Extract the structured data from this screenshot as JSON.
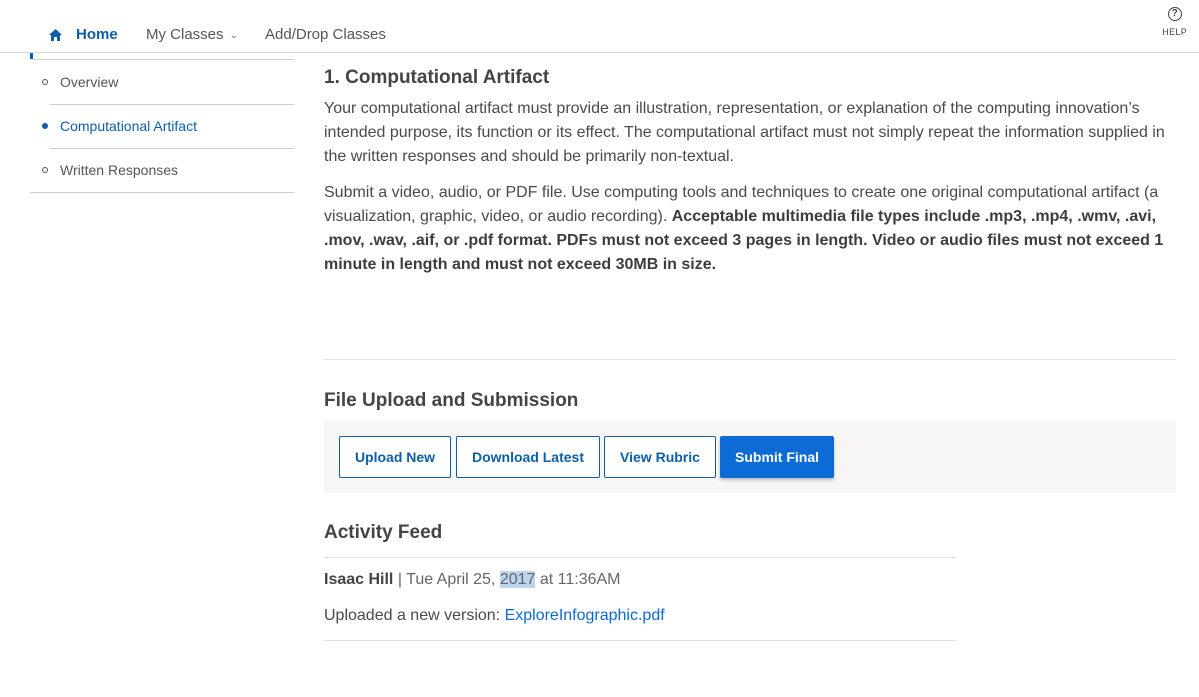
{
  "nav": {
    "home": "Home",
    "my_classes": "My Classes",
    "add_drop": "Add/Drop Classes",
    "help": "HELP",
    "help_glyph": "?"
  },
  "sidebar": {
    "items": [
      {
        "label": "Overview",
        "active": false
      },
      {
        "label": "Computational Artifact",
        "active": true
      },
      {
        "label": "Written Responses",
        "active": false
      }
    ]
  },
  "main": {
    "section_title": "1. Computational Artifact",
    "para1": "Your computational artifact must provide an illustration, representation, or explanation of the computing innovation’s intended purpose, its function or its effect. The computational artifact must not simply repeat the information supplied in the written responses and should be primarily non-textual.",
    "para2_plain": "Submit a video, audio, or PDF file. Use computing tools and techniques to create one original computational artifact (a visualization, graphic, video, or audio recording). ",
    "para2_bold": "Acceptable multimedia file types include .mp3, .mp4, .wmv, .avi, .mov, .wav, .aif, or .pdf format. PDFs must not exceed 3 pages in length. Video or audio files must not exceed 1 minute in length and must not exceed 30MB in size.",
    "upload_title": "File Upload and Submission",
    "buttons": {
      "upload": "Upload New",
      "download": "Download Latest",
      "rubric": "View Rubric",
      "submit": "Submit Final"
    },
    "feed_title": "Activity Feed",
    "feed": {
      "author": "Isaac Hill",
      "separator": " | ",
      "date_prefix": "Tue April 25, ",
      "date_year": "2017",
      "date_suffix": " at 11:36AM",
      "body_prefix": "Uploaded a new version: ",
      "file_link": "ExploreInfographic.pdf"
    }
  },
  "colors": {
    "brand_blue": "#0c5fa8",
    "primary_button": "#0c6bd4",
    "selection_highlight": "#b9d5f0"
  }
}
